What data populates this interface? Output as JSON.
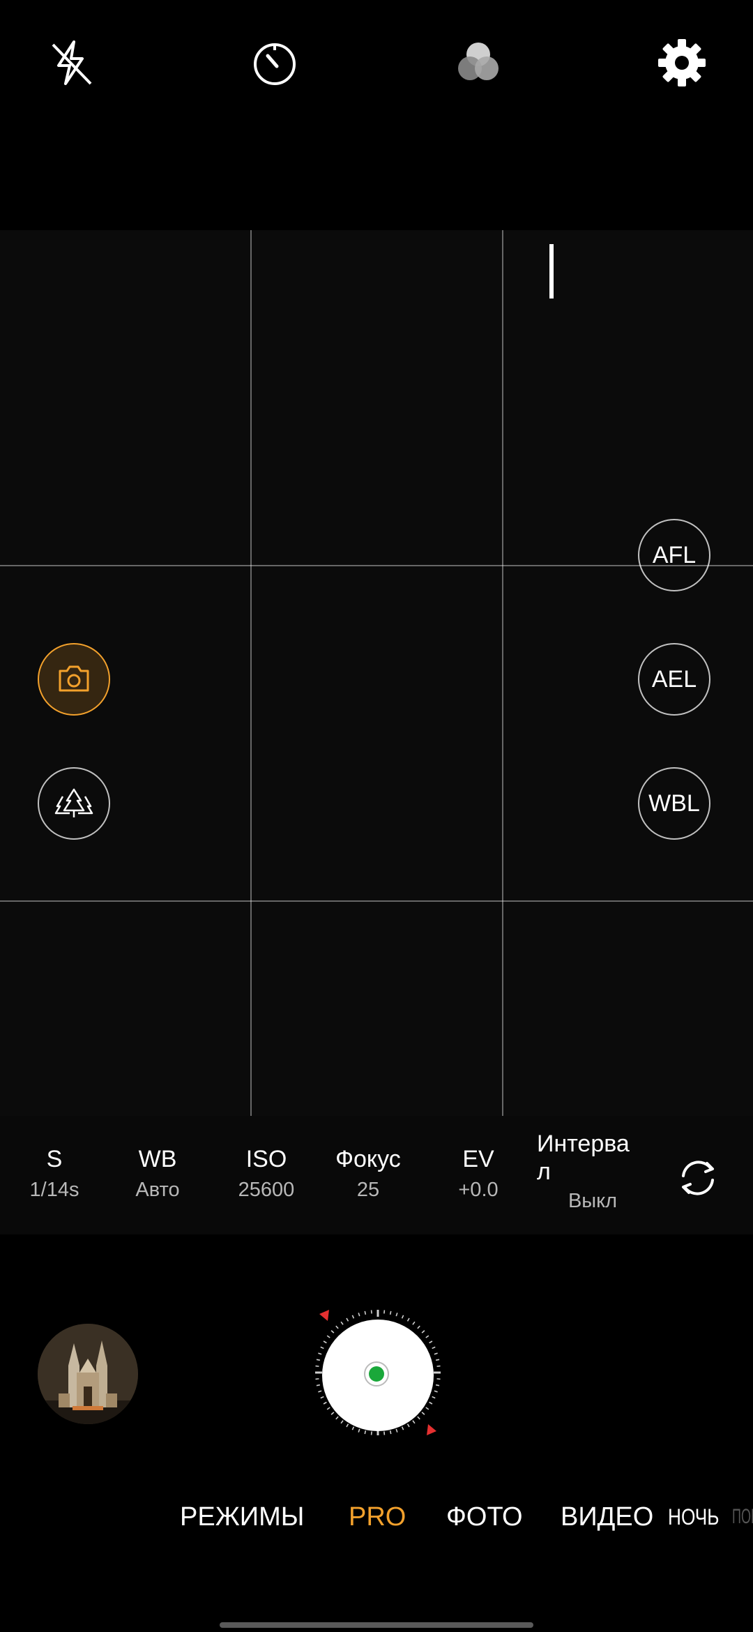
{
  "top_bar": {
    "icons": [
      "flash-off-icon",
      "timer-icon",
      "filters-icon",
      "settings-icon"
    ]
  },
  "viewfinder": {
    "buttons": {
      "afl": "AFL",
      "ael": "AEL",
      "wbl": "WBL"
    },
    "side_icons": [
      "camera-icon",
      "landscape-icon"
    ]
  },
  "pro_settings": [
    {
      "label": "S",
      "value": "1/14s"
    },
    {
      "label": "WB",
      "value": "Авто"
    },
    {
      "label": "ISO",
      "value": "25600"
    },
    {
      "label": "Фокус",
      "value": "25"
    },
    {
      "label": "EV",
      "value": "+0.0"
    }
  ],
  "interval": {
    "label_line1": "Интерва",
    "label_line2": "л",
    "value": "Выкл"
  },
  "modes": {
    "modes_menu": "РЕЖИМЫ",
    "pro": "PRO",
    "photo": "ФОТО",
    "video": "ВИДЕО",
    "night": "НОЧЬ",
    "portrait_partial": "ПОР"
  },
  "colors": {
    "accent": "#f3a12c",
    "shutter_dot": "#1aa83a",
    "dial_marker": "#e53030"
  }
}
